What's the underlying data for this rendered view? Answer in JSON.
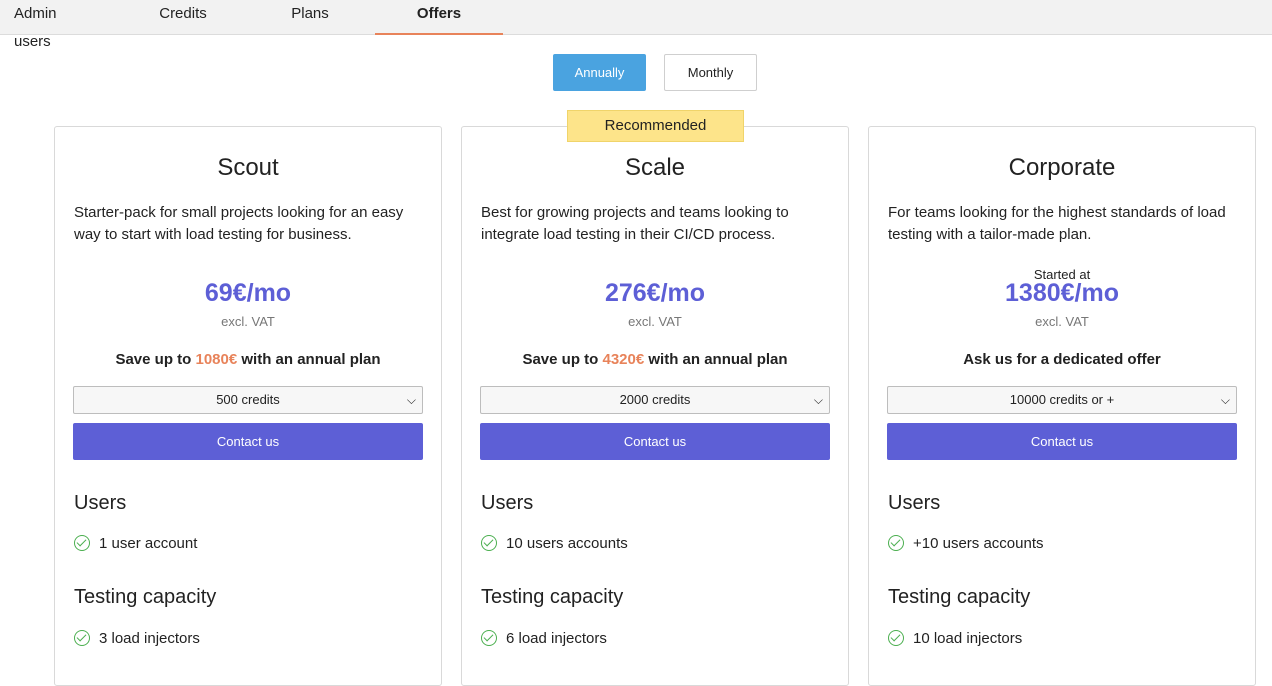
{
  "tabs": [
    {
      "label": "Admin users",
      "active": false
    },
    {
      "label": "Credits",
      "active": false
    },
    {
      "label": "Plans",
      "active": false
    },
    {
      "label": "Offers",
      "active": true
    }
  ],
  "billing_toggle": {
    "annually": "Annually",
    "monthly": "Monthly",
    "selected": "Annually"
  },
  "recommended_badge": "Recommended",
  "plans": [
    {
      "name": "Scout",
      "description": "Starter-pack for small projects looking for an easy way to start with load testing for business.",
      "price_prefix": "",
      "price": "69€/mo",
      "vat_note": "excl. VAT",
      "save_before": "Save up to ",
      "save_amount": "1080€",
      "save_after": " with an annual plan",
      "credits_selected": "500 credits",
      "cta": "Contact us",
      "users_heading": "Users",
      "users_feature": "1 user account",
      "capacity_heading": "Testing capacity",
      "capacity_feature": "3 load injectors"
    },
    {
      "name": "Scale",
      "description": "Best for growing projects and teams looking to integrate load testing in their CI/CD process.",
      "price_prefix": "",
      "price": "276€/mo",
      "vat_note": "excl. VAT",
      "save_before": "Save up to ",
      "save_amount": "4320€",
      "save_after": " with an annual plan",
      "credits_selected": "2000 credits",
      "cta": "Contact us",
      "users_heading": "Users",
      "users_feature": "10 users accounts",
      "capacity_heading": "Testing capacity",
      "capacity_feature": "6 load injectors"
    },
    {
      "name": "Corporate",
      "description": "For teams looking for the highest standards of load testing with a tailor-made plan.",
      "price_prefix": "Started at",
      "price": "1380€/mo",
      "vat_note": "excl. VAT",
      "save_before": "Ask us for a dedicated offer",
      "save_amount": "",
      "save_after": "",
      "credits_selected": "10000 credits or +",
      "cta": "Contact us",
      "users_heading": "Users",
      "users_feature": "+10 users accounts",
      "capacity_heading": "Testing capacity",
      "capacity_feature": "10 load injectors"
    }
  ],
  "colors": {
    "accent": "#5d5fd6",
    "toggle_active": "#4aa3e0",
    "highlight": "#e8835a",
    "badge": "#fde48a",
    "check": "#4caf50"
  }
}
